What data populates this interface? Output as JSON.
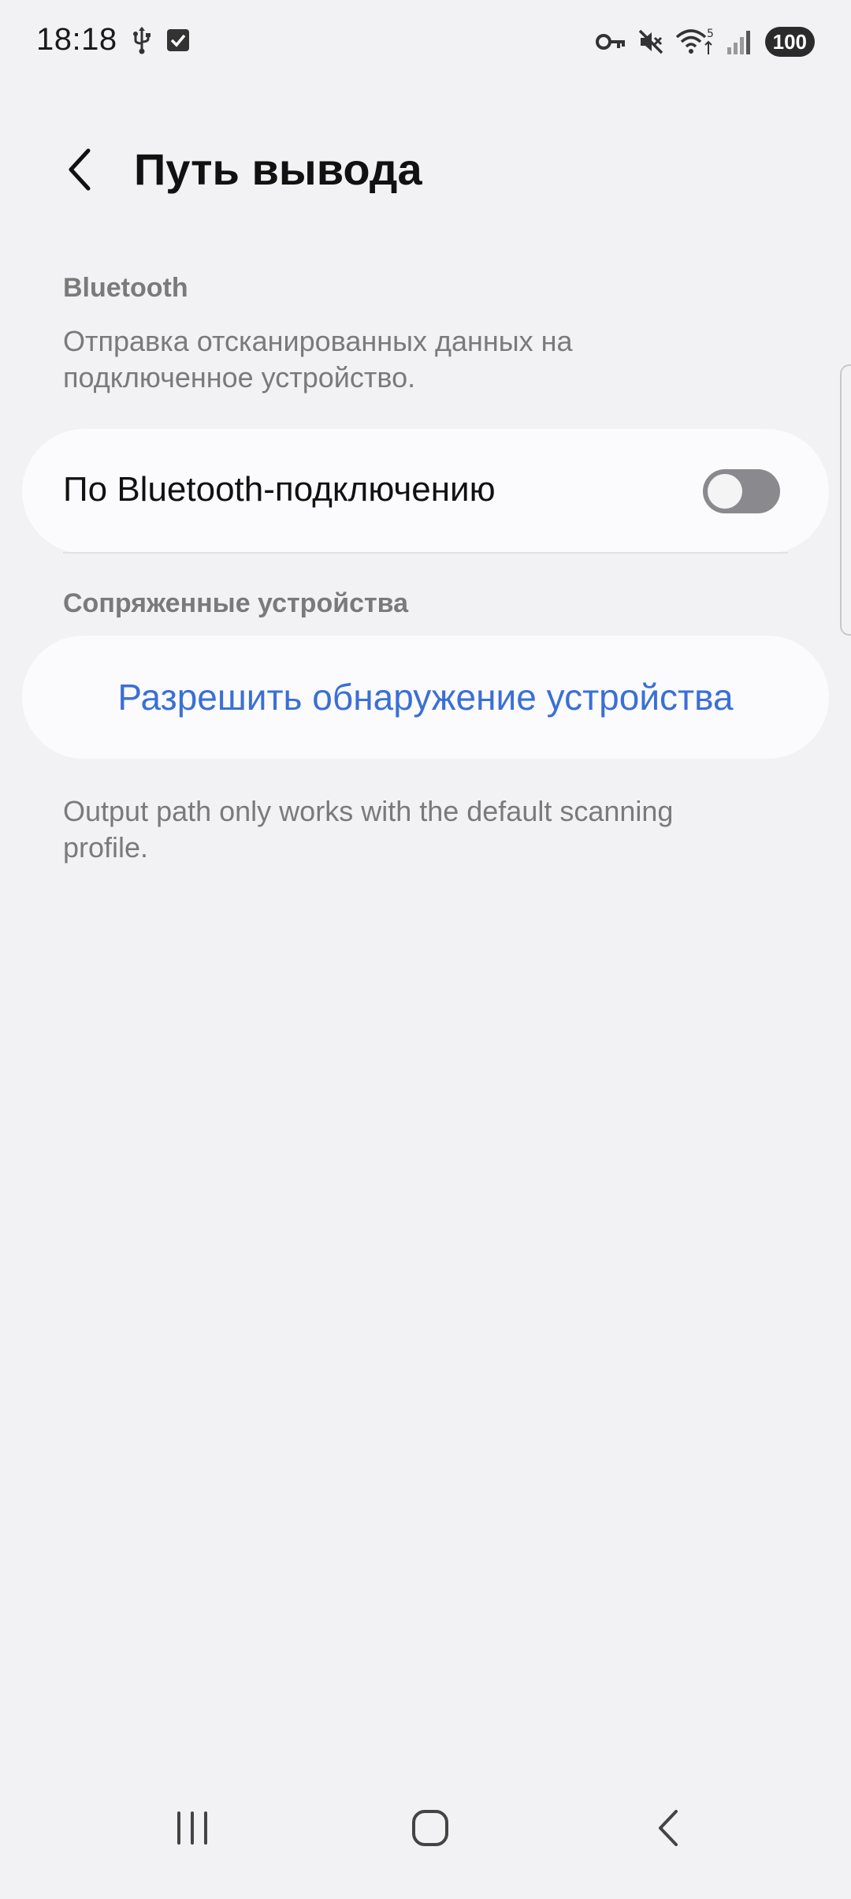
{
  "status_bar": {
    "time": "18:18",
    "icons_left": [
      "usb-icon",
      "check-box-icon"
    ],
    "icons_right": [
      "key-icon",
      "mute-icon",
      "wifi-icon",
      "signal-icon"
    ],
    "wifi_badge": "5",
    "battery": "100"
  },
  "header": {
    "title": "Путь вывода",
    "back_icon": "chevron-left-icon"
  },
  "bluetooth_section": {
    "label": "Bluetooth",
    "description": "Отправка отсканированных данных на подключенное устройство.",
    "toggle_label": "По Bluetooth-подключению",
    "toggle_on": false
  },
  "paired_section": {
    "label": "Сопряженные устройства",
    "discover_button": "Разрешить обнаружение устройства"
  },
  "footer_note": "Output path only works with the default scanning profile.",
  "colors": {
    "background": "#f2f2f4",
    "card": "#fbfbfd",
    "accent": "#3b6fd6",
    "secondary_text": "#7a7a7a",
    "toggle_off": "#8a8a8e"
  },
  "nav_bar": {
    "recents_icon": "recents-icon",
    "home_icon": "home-icon",
    "back_icon": "nav-back-icon"
  }
}
